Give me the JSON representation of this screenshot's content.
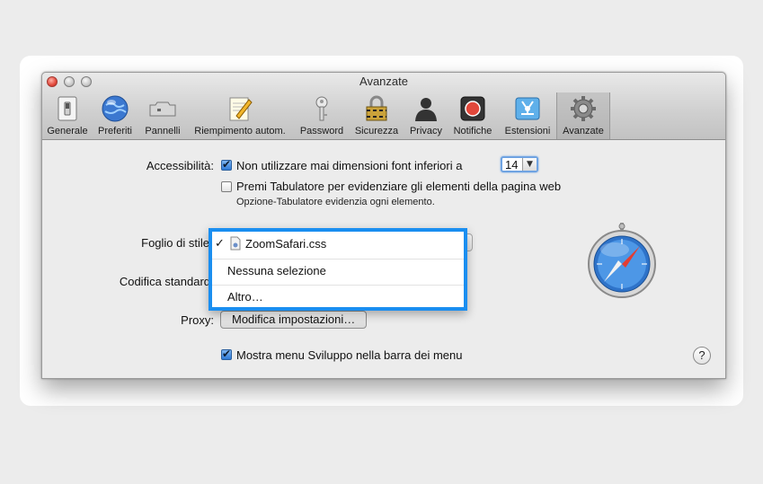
{
  "window": {
    "title": "Avanzate"
  },
  "toolbar": {
    "items": [
      {
        "label": "Generale",
        "icon": "switch-icon"
      },
      {
        "label": "Preferiti",
        "icon": "globe-icon"
      },
      {
        "label": "Pannelli",
        "icon": "tabs-icon"
      },
      {
        "label": "Riempimento autom.",
        "icon": "pencil-paper-icon"
      },
      {
        "label": "Password",
        "icon": "key-icon"
      },
      {
        "label": "Sicurezza",
        "icon": "padlock-icon"
      },
      {
        "label": "Privacy",
        "icon": "silhouette-icon"
      },
      {
        "label": "Notifiche",
        "icon": "notification-icon"
      },
      {
        "label": "Estensioni",
        "icon": "puzzle-icon"
      },
      {
        "label": "Avanzate",
        "icon": "gear-icon",
        "selected": true
      }
    ]
  },
  "accessibility": {
    "label": "Accessibilità:",
    "min_font_label": "Non utilizzare mai dimensioni font inferiori a",
    "min_font_checked": true,
    "min_font_value": "14",
    "tab_label": "Premi Tabulatore per evidenziare gli elementi della pagina web",
    "tab_checked": false,
    "tab_hint": "Opzione-Tabulatore evidenzia ogni elemento."
  },
  "stylesheet": {
    "label": "Foglio di stile",
    "menu": {
      "checkmark": "✓",
      "selected_item": "ZoomSafari.css",
      "items": [
        "Nessuna selezione",
        "Altro…"
      ]
    }
  },
  "encoding": {
    "label": "Codifica standard"
  },
  "proxy": {
    "label": "Proxy:",
    "button_label": "Modifica impostazioni…"
  },
  "develop_menu": {
    "label": "Mostra menu Sviluppo nella barra dei menu",
    "checked": true
  },
  "help": {
    "label": "?"
  },
  "colors": {
    "menu_border": "#1a8ef0",
    "close_button": "#e2483b"
  }
}
